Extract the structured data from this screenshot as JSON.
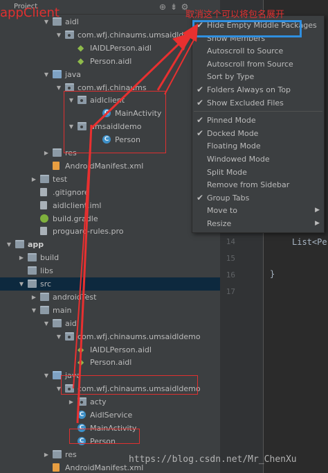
{
  "header": {
    "title": "Project"
  },
  "annotations": {
    "title": "appClient",
    "note": "取消这个可以将包名展开",
    "watermark": "https://blog.csdn.net/Mr_ChenXu"
  },
  "tree": [
    {
      "label": "aidl",
      "icon": "folder",
      "indent": 4,
      "arrow": "down"
    },
    {
      "label": "com.wfj.chinaums.umsaidldemo",
      "icon": "pkg",
      "indent": 5,
      "arrow": "down"
    },
    {
      "label": "IAIDLPerson.aidl",
      "icon": "droid",
      "indent": 6,
      "arrow": ""
    },
    {
      "label": "Person.aidl",
      "icon": "droid",
      "indent": 6,
      "arrow": ""
    },
    {
      "label": "java",
      "icon": "folder-blue",
      "indent": 4,
      "arrow": "down"
    },
    {
      "label": "com.wfj.chinaums",
      "icon": "pkg",
      "indent": 5,
      "arrow": "down"
    },
    {
      "label": "aidlclient",
      "icon": "pkg",
      "indent": 6,
      "arrow": "down"
    },
    {
      "label": "MainActivity",
      "icon": "cls",
      "indent": 8,
      "arrow": ""
    },
    {
      "label": "umsaidldemo",
      "icon": "pkg",
      "indent": 6,
      "arrow": "down"
    },
    {
      "label": "Person",
      "icon": "cls",
      "indent": 8,
      "arrow": ""
    },
    {
      "label": "res",
      "icon": "folder",
      "indent": 4,
      "arrow": "right"
    },
    {
      "label": "AndroidManifest.xml",
      "icon": "xml",
      "indent": 4,
      "arrow": ""
    },
    {
      "label": "test",
      "icon": "folder",
      "indent": 3,
      "arrow": "right"
    },
    {
      "label": ".gitignore",
      "icon": "file",
      "indent": 3,
      "arrow": ""
    },
    {
      "label": "aidlclient.iml",
      "icon": "file",
      "indent": 3,
      "arrow": ""
    },
    {
      "label": "build.gradle",
      "icon": "gradle",
      "indent": 3,
      "arrow": ""
    },
    {
      "label": "proguard-rules.pro",
      "icon": "file",
      "indent": 3,
      "arrow": ""
    },
    {
      "label": "app",
      "icon": "folder",
      "indent": 1,
      "arrow": "down",
      "bold": true
    },
    {
      "label": "build",
      "icon": "folder",
      "indent": 2,
      "arrow": "right"
    },
    {
      "label": "libs",
      "icon": "folder",
      "indent": 2,
      "arrow": ""
    },
    {
      "label": "src",
      "icon": "folder",
      "indent": 2,
      "arrow": "down",
      "selected": true
    },
    {
      "label": "androidTest",
      "icon": "folder",
      "indent": 3,
      "arrow": "right"
    },
    {
      "label": "main",
      "icon": "folder",
      "indent": 3,
      "arrow": "down"
    },
    {
      "label": "aidl",
      "icon": "folder",
      "indent": 4,
      "arrow": "down"
    },
    {
      "label": "com.wfj.chinaums.umsaidldemo",
      "icon": "pkg",
      "indent": 5,
      "arrow": "down"
    },
    {
      "label": "IAIDLPerson.aidl",
      "icon": "droid",
      "indent": 6,
      "arrow": ""
    },
    {
      "label": "Person.aidl",
      "icon": "droid",
      "indent": 6,
      "arrow": ""
    },
    {
      "label": "java",
      "icon": "folder-blue",
      "indent": 4,
      "arrow": "down"
    },
    {
      "label": "com.wfj.chinaums.umsaidldemo",
      "icon": "pkg",
      "indent": 5,
      "arrow": "down"
    },
    {
      "label": "acty",
      "icon": "pkg",
      "indent": 6,
      "arrow": "right"
    },
    {
      "label": "AidlService",
      "icon": "cls",
      "indent": 6,
      "arrow": ""
    },
    {
      "label": "MainActivity",
      "icon": "cls",
      "indent": 6,
      "arrow": ""
    },
    {
      "label": "Person",
      "icon": "cls",
      "indent": 6,
      "arrow": ""
    },
    {
      "label": "res",
      "icon": "folder",
      "indent": 4,
      "arrow": "right"
    },
    {
      "label": "AndroidManifest.xml",
      "icon": "xml",
      "indent": 4,
      "arrow": ""
    }
  ],
  "menu": [
    {
      "label": "Hide Empty Middle Packages",
      "checked": true
    },
    {
      "label": "Show Members",
      "checked": false
    },
    {
      "label": "Autoscroll to Source",
      "checked": false
    },
    {
      "label": "Autoscroll from Source",
      "checked": false
    },
    {
      "label": "Sort by Type",
      "checked": false
    },
    {
      "label": "Folders Always on Top",
      "checked": true
    },
    {
      "label": "Show Excluded Files",
      "checked": true
    },
    {
      "sep": true
    },
    {
      "label": "Pinned Mode",
      "checked": true
    },
    {
      "label": "Docked Mode",
      "checked": true
    },
    {
      "label": "Floating Mode",
      "checked": false
    },
    {
      "label": "Windowed Mode",
      "checked": false
    },
    {
      "label": "Split Mode",
      "checked": false
    },
    {
      "label": "Remove from Sidebar",
      "checked": false
    },
    {
      "label": "Group Tabs",
      "checked": true
    },
    {
      "label": "Move to",
      "checked": false,
      "submenu": true
    },
    {
      "label": "Resize",
      "checked": false,
      "submenu": true
    }
  ],
  "editor": {
    "lines": [
      "14",
      "15",
      "16",
      "17"
    ],
    "code": [
      "List<Pe",
      "}"
    ]
  }
}
